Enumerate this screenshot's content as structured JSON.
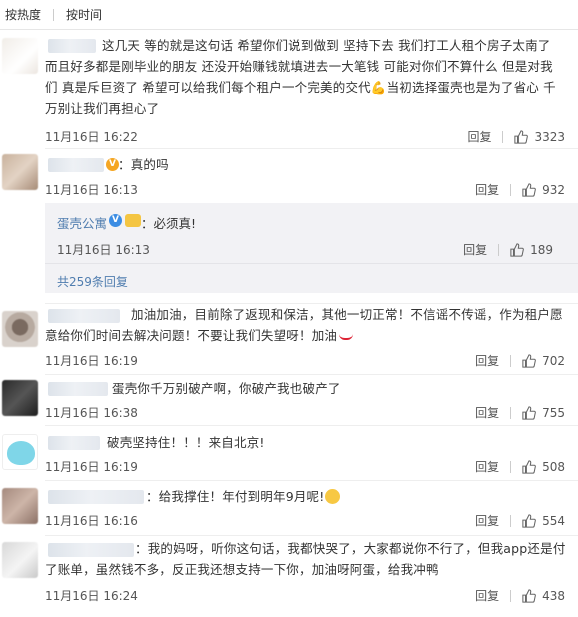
{
  "sort": {
    "hot": "按热度",
    "time": "按时间"
  },
  "actions": {
    "reply": "回复"
  },
  "comments": [
    {
      "text": "这几天 等的就是这句话 希望你们说到做到 坚持下去 我们打工人租个房子太南了 而且好多都是刚毕业的朋友 还没开始赚钱就填进去一大笔钱 可能对你们不算什么 但是对我们 真是斥巨资了 希望可以给我们每个租户一个完美的交代💪当初选择蛋壳也是为了省心 千万别让我们再担心了",
      "time": "11月16日 16:22",
      "likes": "3323"
    },
    {
      "text": "：真的吗",
      "time": "11月16日 16:13",
      "likes": "932",
      "reply": {
        "author": "蛋壳公寓",
        "text": "：必须真!",
        "time": "11月16日 16:13",
        "likes": "189"
      },
      "more": "共259条回复"
    },
    {
      "text": "加油加油，目前除了返现和保洁，其他一切正常！不信谣不传谣，作为租户愿意给你们时间去解决问题！不要让我们失望呀！加油",
      "time": "11月16日 16:19",
      "likes": "702"
    },
    {
      "text": "蛋壳你千万别破产啊，你破产我也破产了",
      "time": "11月16日 16:38",
      "likes": "755"
    },
    {
      "text": "破壳坚持住！！！来自北京!",
      "time": "11月16日 16:19",
      "likes": "508"
    },
    {
      "text": "：给我撑住！年付到明年9月呢!",
      "time": "11月16日 16:16",
      "likes": "554"
    },
    {
      "text": "：我的妈呀，听你这句话，我都快哭了，大家都说你不行了，但我app还是付了账单，虽然钱不多，反正我还想支持一下你，加油呀阿蛋，给我冲鸭",
      "time": "11月16日 16:24",
      "likes": "438"
    }
  ],
  "colors": {
    "link": "#507daf",
    "text": "#333333",
    "divider": "#eeeeee"
  }
}
